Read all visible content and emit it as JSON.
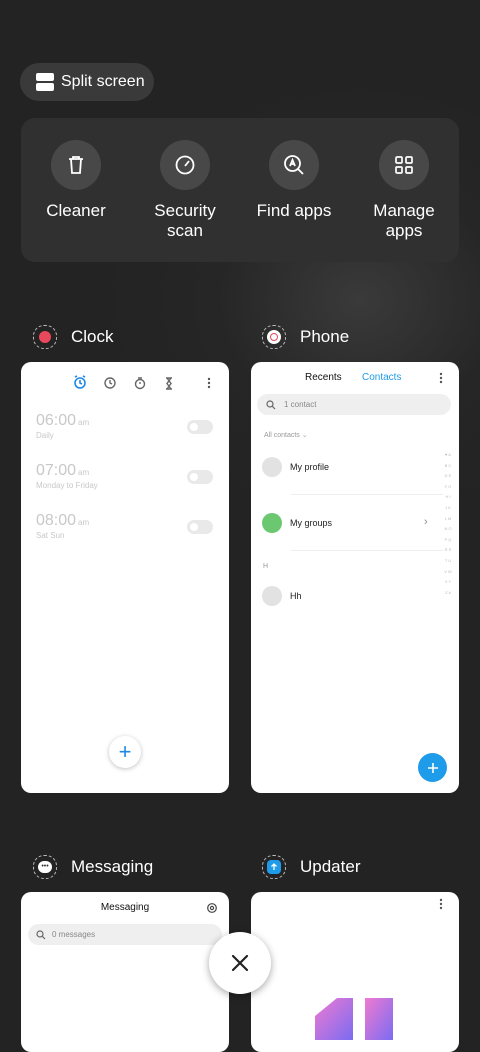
{
  "split_screen": {
    "label": "Split screen"
  },
  "tools": [
    {
      "label": "Cleaner",
      "icon": "trash-icon"
    },
    {
      "label": "Security\nscan",
      "icon": "gauge-icon"
    },
    {
      "label": "Find apps",
      "icon": "search-icon"
    },
    {
      "label": "Manage\napps",
      "icon": "grid-icon"
    }
  ],
  "apps": {
    "clock": {
      "name": "Clock",
      "alarms": [
        {
          "time": "06:00",
          "suffix": "am",
          "repeat": "Daily"
        },
        {
          "time": "07:00",
          "suffix": "am",
          "repeat": "Monday to Friday"
        },
        {
          "time": "08:00",
          "suffix": "am",
          "repeat": "Sat Sun"
        }
      ],
      "add_label": "+"
    },
    "phone": {
      "name": "Phone",
      "tab_recents": "Recents",
      "tab_contacts": "Contacts",
      "search_placeholder": "1 contact",
      "filter": "All contacts",
      "my_profile": "My profile",
      "my_groups": "My groups",
      "section_h": "H",
      "contact_hh": "Hh",
      "index_letters": "♥ A B C D E F G H I J K L M N O P Q R S T U V W X Y Z #",
      "accent": "#1e9be9"
    },
    "messaging": {
      "name": "Messaging",
      "title": "Messaging",
      "search_placeholder": "0 messages"
    },
    "updater": {
      "name": "Updater"
    }
  }
}
